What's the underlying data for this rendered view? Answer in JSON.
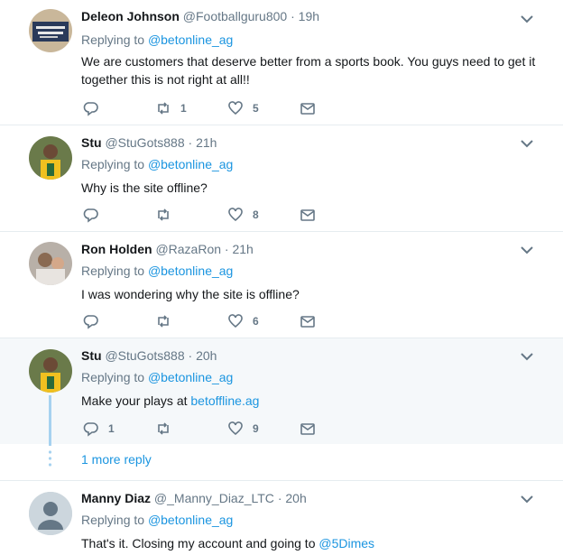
{
  "tweets": [
    {
      "name": "Deleon Johnson",
      "handle": "@Footballguru800",
      "time": "19h",
      "replying_prefix": "Replying to",
      "replying_handle": "@betonline_ag",
      "text": "We are customers that deserve better from a sports book. You guys need to get it together this is not right at all!!",
      "reply_count": "",
      "retweet_count": "1",
      "like_count": "5"
    },
    {
      "name": "Stu",
      "handle": "@StuGots888",
      "time": "21h",
      "replying_prefix": "Replying to",
      "replying_handle": "@betonline_ag",
      "text": "Why is the site offline?",
      "reply_count": "",
      "retweet_count": "",
      "like_count": "8"
    },
    {
      "name": "Ron Holden",
      "handle": "@RazaRon",
      "time": "21h",
      "replying_prefix": "Replying to",
      "replying_handle": "@betonline_ag",
      "text": "I was wondering why the site is offline?",
      "reply_count": "",
      "retweet_count": "",
      "like_count": "6"
    },
    {
      "name": "Stu",
      "handle": "@StuGots888",
      "time": "20h",
      "replying_prefix": "Replying to",
      "replying_handle": "@betonline_ag",
      "text_prefix": "Make your plays at ",
      "text_link": "betoffline.ag",
      "reply_count": "1",
      "retweet_count": "",
      "like_count": "9"
    },
    {
      "name": "Manny Diaz",
      "handle": "@_Manny_Diaz_LTC",
      "time": "20h",
      "replying_prefix": "Replying to",
      "replying_handle": "@betonline_ag",
      "text_prefix": "That's it. Closing my account and going to ",
      "text_link": "@5Dimes"
    }
  ],
  "more_replies_label": "1 more reply",
  "separator": "·",
  "icons": {
    "reply": "reply-icon",
    "retweet": "retweet-icon",
    "like": "heart-icon",
    "dm": "envelope-icon",
    "caret": "chevron-down-icon"
  },
  "colors": {
    "link": "#1b95e0",
    "muted": "#657786",
    "thread_line": "#a6d2f0",
    "highlight_bg": "#f5f8fa"
  }
}
